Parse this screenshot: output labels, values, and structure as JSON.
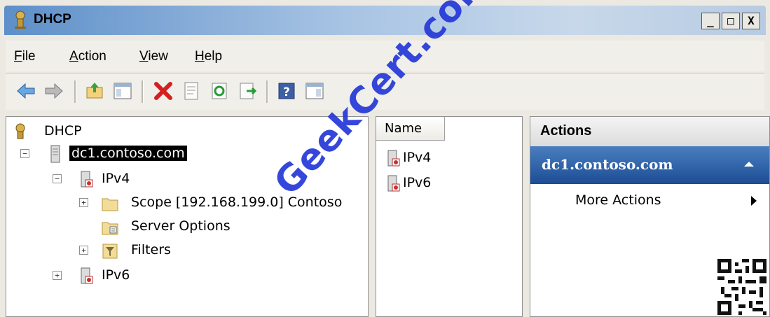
{
  "window": {
    "title": "DHCP",
    "controls": [
      "_",
      "□",
      "X"
    ]
  },
  "menu": [
    {
      "label": "File"
    },
    {
      "label": "Action"
    },
    {
      "label": "View"
    },
    {
      "label": "Help"
    }
  ],
  "toolbar": [
    {
      "icon": "back-arrow-icon"
    },
    {
      "icon": "forward-arrow-icon"
    },
    {
      "icon": "up-folder-icon"
    },
    {
      "icon": "show-hide-console-tree-icon"
    },
    {
      "icon": "delete-icon"
    },
    {
      "icon": "properties-icon"
    },
    {
      "icon": "refresh-icon"
    },
    {
      "icon": "export-list-icon"
    },
    {
      "icon": "help-icon"
    },
    {
      "icon": "show-hide-action-pane-icon"
    }
  ],
  "tree": {
    "root": "DHCP",
    "server": "dc1.contoso.com",
    "ipv4": "IPv4",
    "scope": "Scope [192.168.199.0] Contoso",
    "server_options": "Server Options",
    "filters": "Filters",
    "ipv6": "IPv6",
    "expanders": {
      "server": "−",
      "ipv4": "−",
      "scope": "+",
      "filters": "+",
      "ipv6": "+"
    }
  },
  "list": {
    "column_header": "Name",
    "items": [
      "IPv4",
      "IPv6"
    ]
  },
  "actions": {
    "header": "Actions",
    "section": "dc1.contoso.com",
    "items": [
      "More Actions"
    ]
  },
  "watermark": "GeekCert.com",
  "colors": {
    "action_section_bg": "#1c4d94",
    "watermark": "#2438d8",
    "delete_icon": "#d42020"
  }
}
